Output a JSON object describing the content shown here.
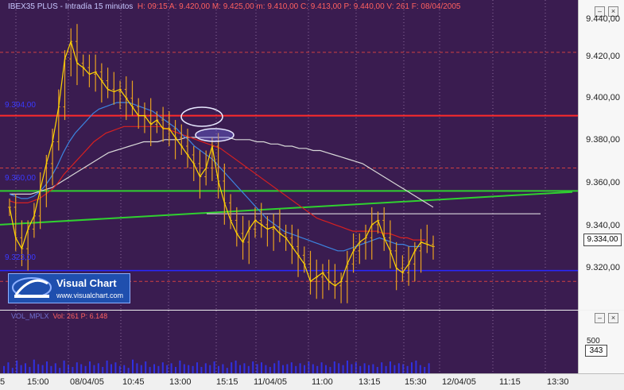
{
  "header": {
    "instrument": "IBEX35 PLUS - Intradía 15 minutos",
    "details": "H: 09:15  A: 9.420,00  M: 9.425,00  m: 9.410,00  C: 9.413,00  P: 9.440,00  V: 261  F: 08/04/2005"
  },
  "volume_header": {
    "name": "VOL_MPLX",
    "details": "Vol: 261  P: 6.148"
  },
  "price_axis": {
    "ticks": [
      "9.440,00",
      "9.420,00",
      "9.400,00",
      "9.380,00",
      "9.360,00",
      "9.340,00",
      "9.320,00"
    ],
    "current_price": "9.334,00"
  },
  "volume_axis": {
    "tick": "500",
    "current_volume": "343"
  },
  "time_axis": {
    "labels": [
      "5",
      "15:00",
      "08/04/05",
      "10:45",
      "13:00",
      "15:15",
      "11/04/05",
      "11:00",
      "13:15",
      "15:30",
      "12/04/05",
      "11:15",
      "13:30"
    ]
  },
  "levels": {
    "resistance_label": "9.394,00",
    "middle_label": "9.360,00",
    "support_label": "9.323,00"
  },
  "logo": {
    "title": "Visual Chart",
    "url": "www.visualchart.com"
  },
  "colors": {
    "background": "#3a1c50",
    "candles": "#e8a020",
    "close_line": "#ffd800",
    "ma_fast": "#3c84e0",
    "ma_mid": "#d82020",
    "ma_slow": "#d8d8d8",
    "resistance": "#ff2a2a",
    "trendline": "#30d030",
    "support": "#2828ff",
    "volume": "#3030e0"
  },
  "chart_data": {
    "type": "line",
    "title": "IBEX35 PLUS - Intradía 15 minutos",
    "ylim": [
      9305,
      9447
    ],
    "close": [
      9352,
      9338,
      9333,
      9342,
      9348,
      9360,
      9372,
      9382,
      9398,
      9420,
      9428,
      9418,
      9416,
      9413,
      9414,
      9410,
      9406,
      9405,
      9406,
      9402,
      9398,
      9394,
      9394,
      9390,
      9392,
      9388,
      9388,
      9384,
      9380,
      9376,
      9372,
      9366,
      9370,
      9380,
      9364,
      9354,
      9346,
      9340,
      9336,
      9342,
      9346,
      9344,
      9342,
      9343,
      9340,
      9338,
      9334,
      9330,
      9326,
      9318,
      9320,
      9322,
      9318,
      9316,
      9318,
      9326,
      9332,
      9336,
      9338,
      9344,
      9346,
      9338,
      9332,
      9324,
      9322,
      9326,
      9332,
      9336,
      9335,
      9334
    ],
    "ma_fast": [
      9358,
      9357,
      9356,
      9356,
      9357,
      9359,
      9362,
      9366,
      9371,
      9377,
      9382,
      9386,
      9389,
      9392,
      9395,
      9397,
      9398,
      9399,
      9400,
      9400,
      9400,
      9399,
      9398,
      9397,
      9396,
      9394,
      9392,
      9390,
      9388,
      9385,
      9383,
      9380,
      9378,
      9376,
      9374,
      9371,
      9368,
      9365,
      9362,
      9359,
      9356,
      9353,
      9350,
      9347,
      9345,
      9343,
      9341,
      9340,
      9339,
      9338,
      9337,
      9336,
      9335,
      9334,
      9333,
      9332,
      9332,
      9333,
      9334,
      9335,
      9336,
      9337,
      9338,
      9337,
      9336,
      9335,
      9335,
      9334,
      9334,
      9334
    ],
    "ma_mid": [
      9355,
      9354,
      9354,
      9354,
      9355,
      9356,
      9358,
      9360,
      9363,
      9367,
      9370,
      9373,
      9376,
      9379,
      9382,
      9384,
      9386,
      9387,
      9388,
      9389,
      9389,
      9389,
      9389,
      9389,
      9389,
      9389,
      9388,
      9387,
      9386,
      9385,
      9384,
      9383,
      9382,
      9381,
      9380,
      9379,
      9377,
      9375,
      9373,
      9371,
      9369,
      9367,
      9365,
      9363,
      9361,
      9359,
      9357,
      9355,
      9353,
      9351,
      9349,
      9347,
      9346,
      9345,
      9344,
      9343,
      9342,
      9341,
      9341,
      9341,
      9341,
      9341,
      9340,
      9340,
      9339,
      9338,
      9338,
      9337,
      9337,
      9337
    ],
    "ma_slow": [
      9358,
      9358,
      9358,
      9358,
      9359,
      9360,
      9361,
      9363,
      9365,
      9367,
      9369,
      9371,
      9373,
      9375,
      9377,
      9378,
      9379,
      9380,
      9381,
      9382,
      9382,
      9382,
      9383,
      9383,
      9383,
      9384,
      9384,
      9384,
      9384,
      9384,
      9384,
      9384,
      9383,
      9383,
      9383,
      9382,
      9382,
      9381,
      9381,
      9380,
      9380,
      9379,
      9379,
      9378,
      9378,
      9377,
      9376,
      9375,
      9374,
      9373,
      9372,
      9370,
      9368,
      9366,
      9364,
      9362,
      9360,
      9358,
      9356,
      9354,
      9352
    ],
    "resistance": 9394,
    "support": 9323,
    "support_dashed": [
      9423,
      9370,
      9318
    ],
    "trendline": [
      [
        0,
        9344
      ],
      [
        720,
        9359
      ]
    ],
    "volume": [
      80,
      120,
      60,
      140,
      90,
      110,
      70,
      150,
      100,
      90,
      130,
      80,
      110,
      60,
      140,
      90,
      70,
      120,
      100,
      80,
      130,
      90,
      110,
      70,
      140,
      100,
      120,
      80,
      90,
      60,
      150,
      110,
      90,
      130,
      70,
      100,
      80,
      120,
      90,
      110,
      70,
      140,
      100,
      90,
      80,
      120,
      70,
      110,
      90,
      130,
      80,
      100,
      60,
      120,
      140,
      90,
      110,
      80,
      130,
      100,
      120,
      90,
      70,
      110,
      140,
      90,
      100,
      120,
      80,
      110,
      90,
      130,
      100,
      80,
      120,
      90,
      70,
      130,
      110,
      90,
      140,
      100,
      120,
      80,
      110,
      90,
      100,
      70,
      120,
      80,
      130,
      90,
      110,
      100,
      80,
      120,
      140,
      90,
      70,
      110
    ]
  }
}
